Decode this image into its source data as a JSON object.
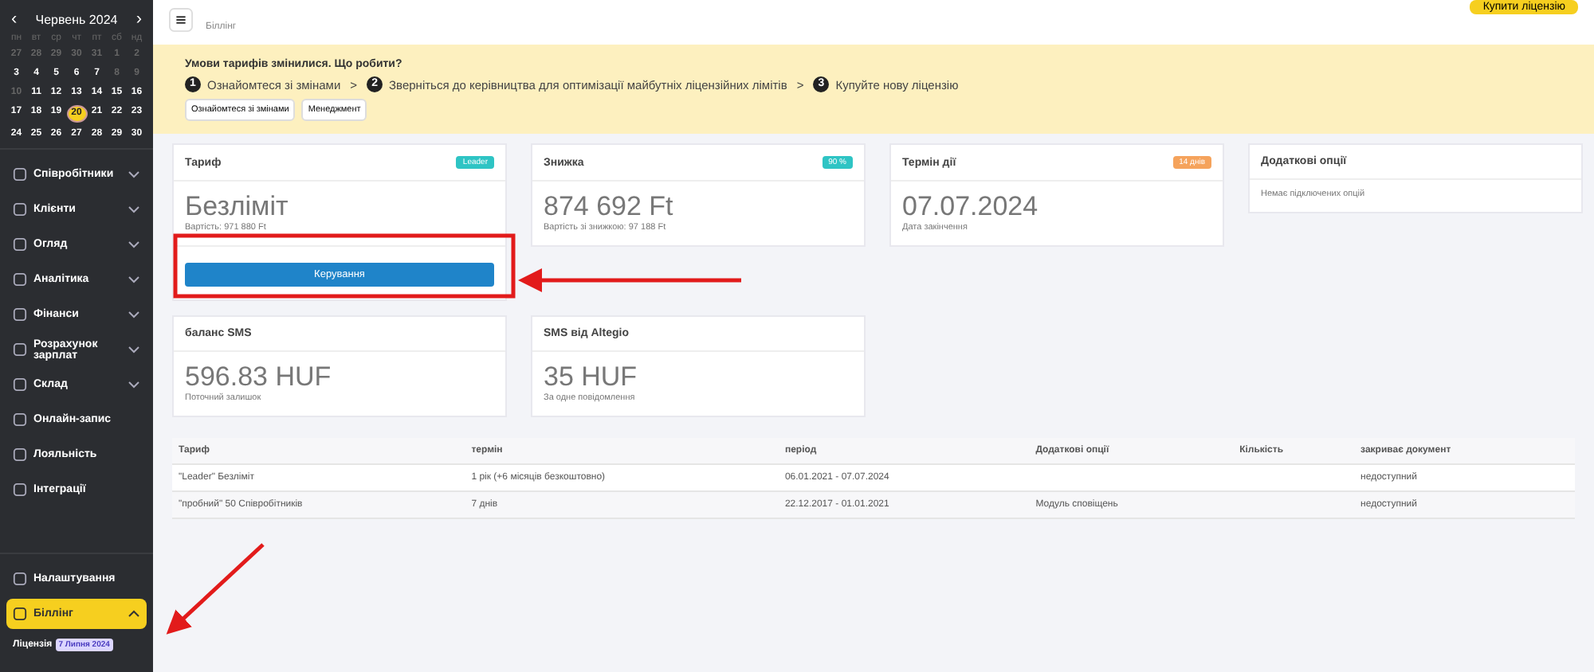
{
  "calendar": {
    "month": "Червень 2024",
    "prev": "‹",
    "next": "›",
    "weekdays": [
      "пн",
      "вт",
      "ср",
      "чт",
      "пт",
      "сб",
      "нд"
    ],
    "weeks": [
      [
        {
          "day": "27",
          "muted": true,
          "selected": false
        },
        {
          "day": "28",
          "muted": true,
          "selected": false
        },
        {
          "day": "29",
          "muted": true,
          "selected": false
        },
        {
          "day": "30",
          "muted": true,
          "selected": false
        },
        {
          "day": "31",
          "muted": true,
          "selected": false
        },
        {
          "day": "1",
          "muted": true,
          "selected": false
        },
        {
          "day": "2",
          "muted": true,
          "selected": false
        }
      ],
      [
        {
          "day": "3",
          "muted": false,
          "selected": false
        },
        {
          "day": "4",
          "muted": false,
          "selected": false
        },
        {
          "day": "5",
          "muted": false,
          "selected": false
        },
        {
          "day": "6",
          "muted": false,
          "selected": false
        },
        {
          "day": "7",
          "muted": false,
          "selected": false
        },
        {
          "day": "8",
          "muted": true,
          "selected": false
        },
        {
          "day": "9",
          "muted": true,
          "selected": false
        }
      ],
      [
        {
          "day": "10",
          "muted": true,
          "selected": false
        },
        {
          "day": "11",
          "muted": false,
          "selected": false
        },
        {
          "day": "12",
          "muted": false,
          "selected": false
        },
        {
          "day": "13",
          "muted": false,
          "selected": false
        },
        {
          "day": "14",
          "muted": false,
          "selected": false
        },
        {
          "day": "15",
          "muted": false,
          "selected": false
        },
        {
          "day": "16",
          "muted": false,
          "selected": false
        }
      ],
      [
        {
          "day": "17",
          "muted": false,
          "selected": false
        },
        {
          "day": "18",
          "muted": false,
          "selected": false
        },
        {
          "day": "19",
          "muted": false,
          "selected": false
        },
        {
          "day": "20",
          "muted": false,
          "selected": true
        },
        {
          "day": "21",
          "muted": false,
          "selected": false
        },
        {
          "day": "22",
          "muted": false,
          "selected": false
        },
        {
          "day": "23",
          "muted": false,
          "selected": false
        }
      ],
      [
        {
          "day": "24",
          "muted": false,
          "selected": false
        },
        {
          "day": "25",
          "muted": false,
          "selected": false
        },
        {
          "day": "26",
          "muted": false,
          "selected": false
        },
        {
          "day": "27",
          "muted": false,
          "selected": false
        },
        {
          "day": "28",
          "muted": false,
          "selected": false
        },
        {
          "day": "29",
          "muted": false,
          "selected": false
        },
        {
          "day": "30",
          "muted": false,
          "selected": false
        }
      ]
    ]
  },
  "sidebar": {
    "items": [
      {
        "label": "Співробітники",
        "expanded": false,
        "selected": false
      },
      {
        "label": "Клієнти",
        "expanded": false,
        "selected": false
      },
      {
        "label": "Огляд",
        "expanded": false,
        "selected": false
      },
      {
        "label": "Аналітика",
        "expanded": false,
        "selected": false
      },
      {
        "label": "Фінанси",
        "expanded": false,
        "selected": false
      },
      {
        "label": "Розрахунок зарплат",
        "expanded": false,
        "selected": false
      },
      {
        "label": "Склад",
        "expanded": false,
        "selected": false
      },
      {
        "label": "Онлайн-запис",
        "selected": false
      },
      {
        "label": "Лояльність",
        "selected": false
      },
      {
        "label": "Інтеграції",
        "selected": false
      }
    ],
    "bottom_items": [
      {
        "label": "Налаштування",
        "selected": false
      },
      {
        "label": "Біллінг",
        "expanded": true,
        "selected": true,
        "children": [
          {
            "label": "Ліцензія",
            "badge": "7 Липня 2024"
          }
        ]
      }
    ]
  },
  "header": {
    "breadcrumb": "Біллінг",
    "buy_button": "Купити ліцензію"
  },
  "banner": {
    "title": "Умови тарифів змінилися. Що робити?",
    "steps": [
      {
        "number": "1",
        "text": "Ознайомтеся зі змінами"
      },
      {
        "number": "2",
        "text": "Зверніться до керівництва для оптимізації майбутніх ліцензійних лімітів"
      },
      {
        "number": "3",
        "text": "Купуйте нову ліцензію"
      }
    ],
    "separator": ">",
    "buttons": [
      "Ознайомтеся зі змінами",
      "Менеджмент"
    ]
  },
  "cards": [
    {
      "title": "Тариф",
      "badge": "Leader",
      "color": "#2ec4c4",
      "value": "Безліміт",
      "caption": "Вартість: 971 880 Ft",
      "action": "Керування"
    },
    {
      "title": "Знижка",
      "badge": "90 %",
      "color": "#2ec4c4",
      "value": "874 692 Ft",
      "caption": "Вартість зі знижкою: 97 188 Ft"
    },
    {
      "title": "Термін дії",
      "badge": "14 днів",
      "color": "#f5a35c",
      "value": "07.07.2024",
      "caption": "Дата закінчення"
    },
    {
      "title": "Додаткові опції",
      "note": "Немає підключених опцій"
    },
    {
      "title": "баланс SMS",
      "value": "596.83 HUF",
      "caption": "Поточний залишок"
    },
    {
      "title": "SMS від Altegio",
      "value": "35 HUF",
      "caption": "За одне повідомлення"
    }
  ],
  "table": {
    "columns": [
      "Тариф",
      "термін",
      "період",
      "Додаткові опції",
      "Кількість",
      "закриває документ"
    ],
    "rows": [
      [
        "\"Leader\" Безліміт",
        "1 рік (+6 місяців безкоштовно)",
        "06.01.2021 - 07.07.2024",
        "",
        "",
        "недоступний"
      ],
      [
        "\"пробний\" 50 Співробітників",
        "7 днів",
        "22.12.2017 - 01.01.2021",
        "Модуль сповіщень",
        "",
        "недоступний"
      ]
    ]
  }
}
